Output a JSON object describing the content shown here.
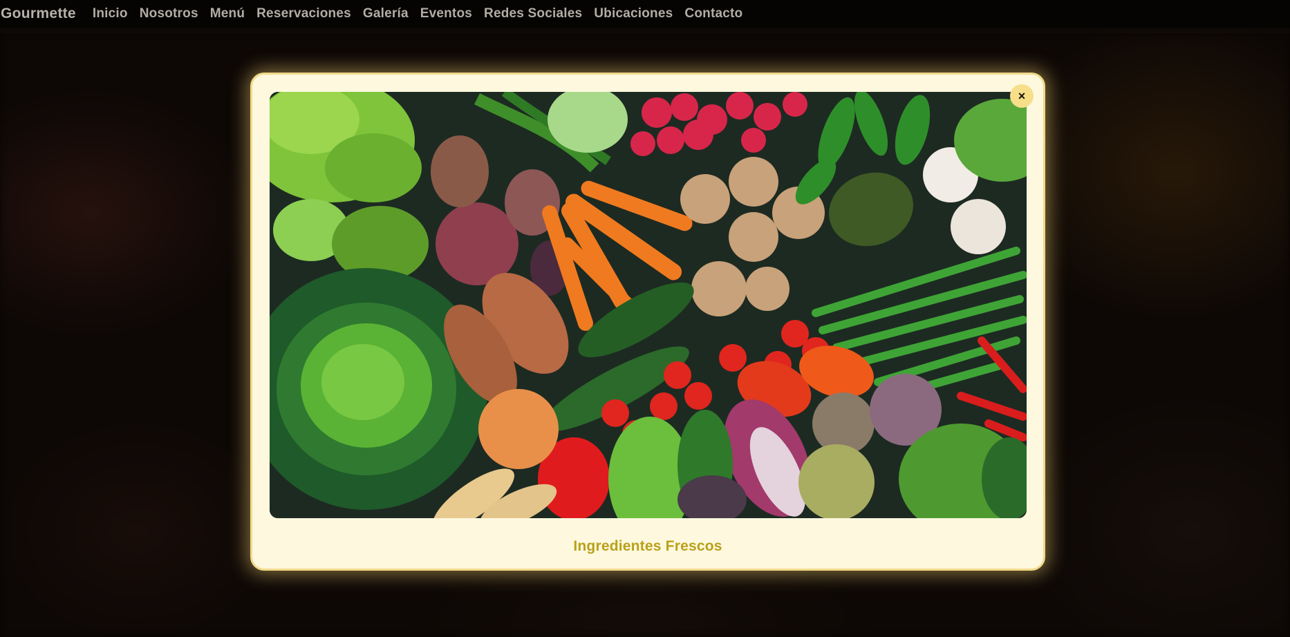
{
  "navbar": {
    "brand": "Gourmette",
    "links": [
      {
        "label": "Inicio"
      },
      {
        "label": "Nosotros"
      },
      {
        "label": "Menú"
      },
      {
        "label": "Reservaciones"
      },
      {
        "label": "Galería"
      },
      {
        "label": "Eventos"
      },
      {
        "label": "Redes Sociales"
      },
      {
        "label": "Ubicaciones"
      },
      {
        "label": "Contacto"
      }
    ]
  },
  "modal": {
    "close_label": "×",
    "caption": "Ingredientes Frescos",
    "image_subject": "assorted-fresh-vegetables"
  },
  "colors": {
    "accent": "#f6df88",
    "caption": "#b9a11a",
    "modal_bg": "#fdf8de",
    "navbar_bg": "#050403"
  }
}
